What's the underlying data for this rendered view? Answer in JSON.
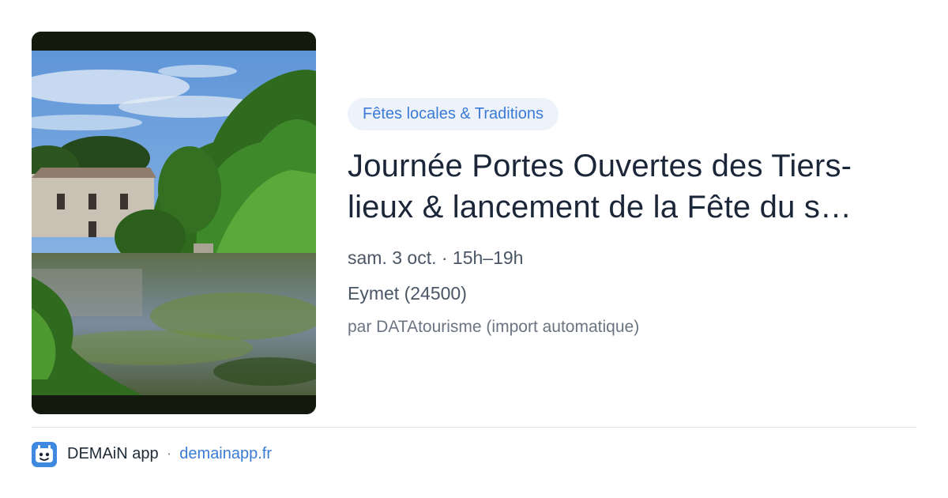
{
  "event": {
    "category": "Fêtes locales & Traditions",
    "title_line1": "Journée Portes Ouvertes des Tiers-",
    "title_line2": "lieux & lancement de la Fête du s…",
    "date": "sam. 3 oct. · 15h–19h",
    "location": "Eymet (24500)",
    "source": "par DATAtourisme (import automatique)"
  },
  "footer": {
    "app_name": "DEMAiN app",
    "separator": "·",
    "url": "demainapp.fr",
    "logo_icon": "demain-app-logo-icon"
  },
  "colors": {
    "accent": "#3a7bd5",
    "tag_background": "#eef3fb",
    "title": "#1b2638",
    "divider": "#dde3ea"
  }
}
